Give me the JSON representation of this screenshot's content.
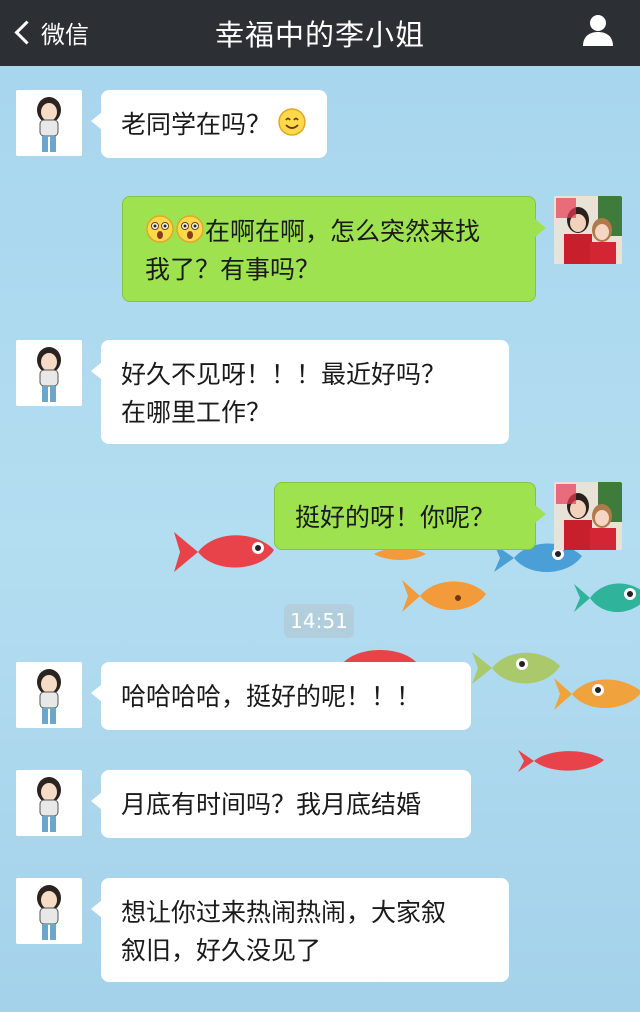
{
  "header": {
    "back_label": "微信",
    "title": "幸福中的李小姐",
    "profile_icon": "person-icon"
  },
  "colors": {
    "header_bg": "#2c2f34",
    "outgoing_bubble": "#9ee34f",
    "incoming_bubble": "#ffffff",
    "chat_bg": "#a9d7ee"
  },
  "messages": [
    {
      "side": "in",
      "text": "老同学在吗？",
      "emoji": "smiley-emoji"
    },
    {
      "side": "out",
      "prefix_emoji": "surprised-emoji x2",
      "line1": "在啊在啊，怎么突然来找",
      "line2": "我了？有事吗？"
    },
    {
      "side": "in",
      "line1": "好久不见呀！！！最近好吗？",
      "line2": "在哪里工作？"
    },
    {
      "side": "out",
      "text": "挺好的呀！你呢？"
    },
    {
      "side": "in",
      "text": "哈哈哈哈，挺好的呢！！！"
    },
    {
      "side": "in",
      "text": "月底有时间吗？我月底结婚"
    },
    {
      "side": "in",
      "line1": "想让你过来热闹热闹，大家叙",
      "line2": "叙旧，好久没见了"
    }
  ],
  "timestamp": "14:51"
}
